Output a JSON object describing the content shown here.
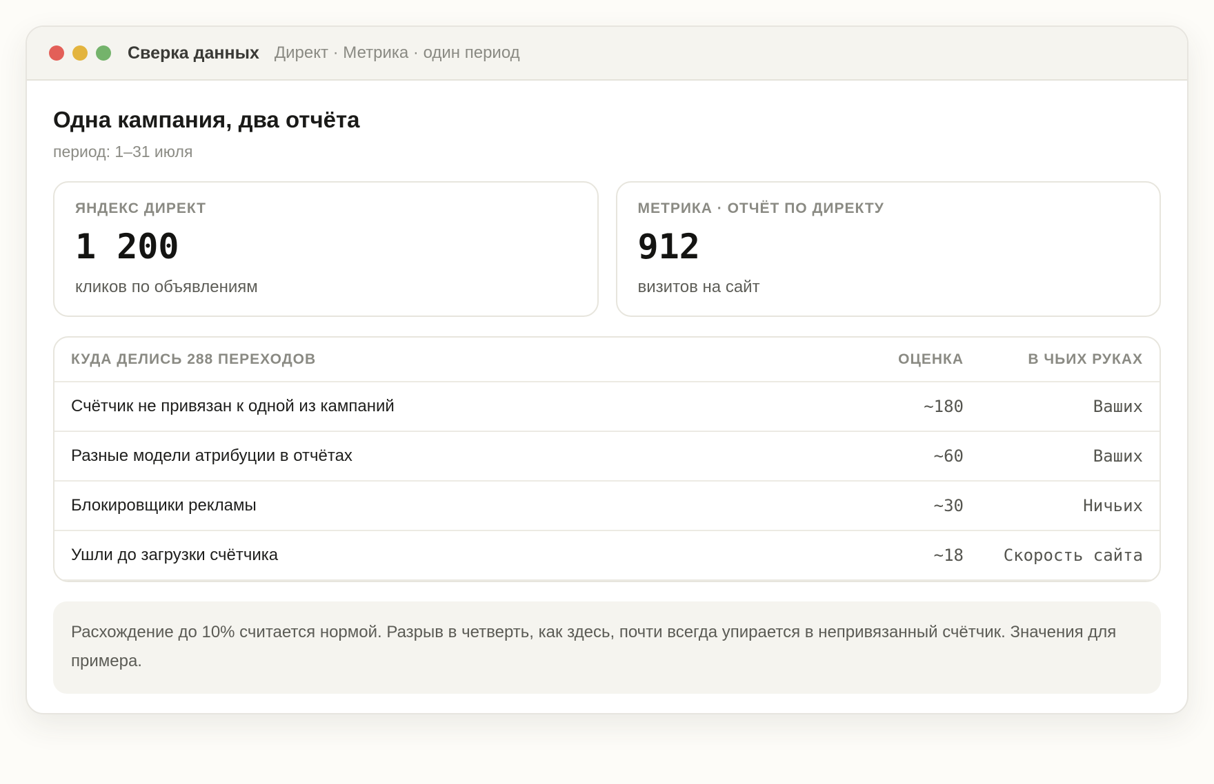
{
  "window": {
    "title": "Сверка данных",
    "subtitle": "Директ · Метрика · один период"
  },
  "header": {
    "title": "Одна кампания, два отчёта",
    "period": "период: 1–31 июля"
  },
  "cards": [
    {
      "label": "ЯНДЕКС ДИРЕКТ",
      "value": "1 200",
      "description": "кликов по объявлениям"
    },
    {
      "label": "МЕТРИКА · ОТЧЁТ ПО ДИРЕКТУ",
      "value": "912",
      "description": "визитов на сайт"
    }
  ],
  "table": {
    "headers": {
      "reason": "КУДА ДЕЛИСЬ 288 ПЕРЕХОДОВ",
      "estimate": "ОЦЕНКА",
      "owner": "В ЧЬИХ РУКАХ"
    },
    "rows": [
      {
        "reason": "Счётчик не привязан к одной из кампаний",
        "estimate": "~180",
        "owner": "Ваших"
      },
      {
        "reason": "Разные модели атрибуции в отчётах",
        "estimate": "~60",
        "owner": "Ваших"
      },
      {
        "reason": "Блокировщики рекламы",
        "estimate": "~30",
        "owner": "Ничьих"
      },
      {
        "reason": "Ушли до загрузки счётчика",
        "estimate": "~18",
        "owner": "Скорость сайта"
      }
    ]
  },
  "note": "Расхождение до 10% считается нормой. Разрыв в четверть, как здесь, почти всегда упирается в непривязанный счётчик. Значения для примера.",
  "colors": {
    "close": "#e35f58",
    "minimize": "#e3b43e",
    "maximize": "#74b36b"
  }
}
